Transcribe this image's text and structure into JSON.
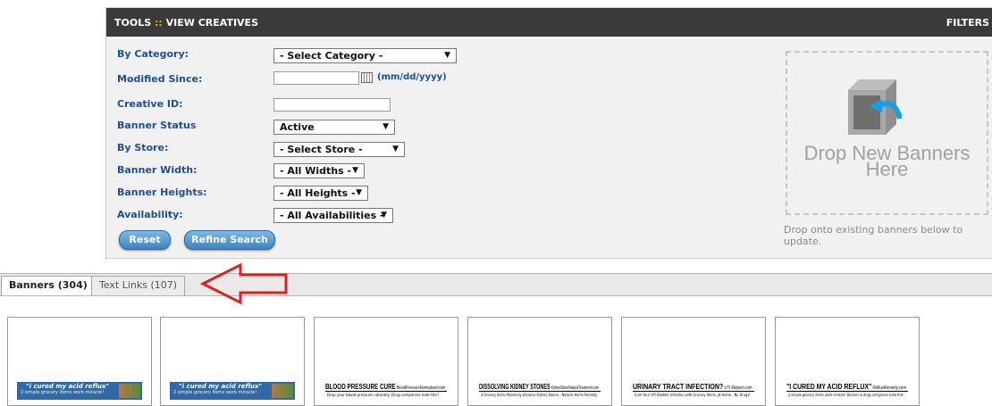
{
  "header": {
    "tools": "TOOLS",
    "separator": "::",
    "view": "VIEW CREATIVES",
    "filters": "FILTERS"
  },
  "form": {
    "category_label": "By Category:",
    "category_value": "- Select Category -",
    "modified_label": "Modified Since:",
    "modified_value": "",
    "date_hint": "(mm/dd/yyyy)",
    "creative_id_label": "Creative ID:",
    "creative_id_value": "",
    "status_label": "Banner Status",
    "status_value": "Active",
    "store_label": "By Store:",
    "store_value": "- Select Store -",
    "width_label": "Banner Width:",
    "width_value": "- All Widths -",
    "height_label": "Banner Heights:",
    "height_value": "- All Heights -",
    "availability_label": "Availability:",
    "availability_value": "- All Availabilities -",
    "reset_label": "Reset",
    "refine_label": "Refine Search"
  },
  "dropzone": {
    "text_line1": "Drop New Banners",
    "text_line2": "Here",
    "note": "Drop onto existing banners below to update."
  },
  "tabs": [
    {
      "label": "Banners (304)",
      "active": true
    },
    {
      "label": "Text Links (107)",
      "active": false
    }
  ],
  "banners": [
    {
      "style": "blue",
      "headline": "\"i cured my acid reflux\"",
      "sub": "2 simple grocery items work miracle!"
    },
    {
      "style": "blue",
      "headline": "\"i cured my acid reflux\"",
      "sub": "2 simple grocery items work miracle!"
    },
    {
      "style": "text",
      "headline": "BLOOD PRESSURE CURE",
      "domain": "BloodPressureNormalized.com",
      "sub": "Drop your blood pressure naturally. Drug companies hate this!"
    },
    {
      "style": "text",
      "headline": "DISSOLVING KIDNEY STONES",
      "domain": "KidneyStoneNaturalTreatment.com",
      "sub": "3 Grocery Items Painlessly Dissolve Kidney Stones - Natural Home Remedy"
    },
    {
      "style": "text",
      "headline": "URINARY TRACT INFECTION?",
      "domain": "UTI-Report.com",
      "sub": "Cure Your UTI Bladder Infection with Grocery Items, at Home - No Drugs!"
    },
    {
      "style": "text",
      "headline": "\"I CURED MY ACID REFLUX\"",
      "domain": "RefluxRemedy.com",
      "sub": "2 simple grocery items work miracle! Doctors & drug companies hate this!"
    }
  ],
  "colors": {
    "header_bg": "#3a3a3a",
    "label_blue": "#1f4f93",
    "button_blue": "#3d84c2",
    "annotation_red": "#e02020"
  }
}
